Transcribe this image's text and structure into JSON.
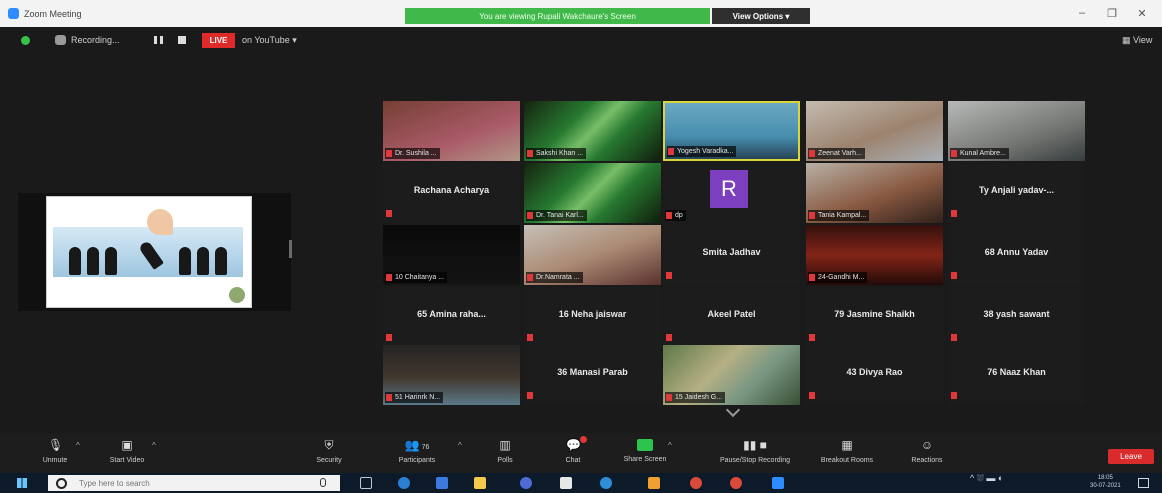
{
  "window": {
    "title": "Zoom Meeting",
    "share_banner": "You are viewing Rupali Wakchaure's Screen",
    "view_options": "View Options",
    "controls": [
      "–",
      "❐",
      "✕"
    ]
  },
  "recording_bar": {
    "recording_label": "Recording...",
    "live_badge": "LIVE",
    "live_platform": "on YouTube ▾",
    "view_label": "View"
  },
  "gallery": [
    {
      "kind": "video",
      "name": "Dr. Sushila ...",
      "video": "v-pink",
      "speaking": false
    },
    {
      "kind": "video",
      "name": "Sakshi Khan ...",
      "video": "v-dna",
      "speaking": false
    },
    {
      "kind": "video",
      "name": "Yogesh Varadka...",
      "video": "v-blue",
      "speaking": true
    },
    {
      "kind": "video",
      "name": "Zeenat Varh...",
      "video": "v-room",
      "speaking": false
    },
    {
      "kind": "video",
      "name": "Kunal Ambre...",
      "video": "v-lightroom",
      "speaking": false
    },
    {
      "kind": "name",
      "name": "Rachana Acharya"
    },
    {
      "kind": "video",
      "name": "Dr. Tanai Karl...",
      "video": "v-dna",
      "speaking": false
    },
    {
      "kind": "avatar",
      "name": "dp",
      "letter": "R"
    },
    {
      "kind": "video",
      "name": "Tania Kampal...",
      "video": "v-girl",
      "speaking": false
    },
    {
      "kind": "name",
      "name": "Ty Anjali yadav-..."
    },
    {
      "kind": "video",
      "name": "10 Chaitanya ...",
      "video": "v-dark",
      "speaking": false
    },
    {
      "kind": "video",
      "name": "Dr.Namrata ...",
      "video": "v-woman",
      "speaking": false
    },
    {
      "kind": "name",
      "name": "Smita Jadhav"
    },
    {
      "kind": "video",
      "name": "24-Gandhi M...",
      "video": "v-red",
      "speaking": false
    },
    {
      "kind": "name",
      "name": "68 Annu Yadav"
    },
    {
      "kind": "name",
      "name": "65 Amina raha..."
    },
    {
      "kind": "name",
      "name": "16 Neha jaiswar"
    },
    {
      "kind": "name",
      "name": "Akeel Patel"
    },
    {
      "kind": "name",
      "name": "79 Jasmine Shaikh"
    },
    {
      "kind": "name",
      "name": "38 yash sawant"
    },
    {
      "kind": "video",
      "name": "51 Harinrk N...",
      "video": "v-boy",
      "speaking": false
    },
    {
      "kind": "name",
      "name": "36 Manasi Parab"
    },
    {
      "kind": "video",
      "name": "15 Jaidesh G...",
      "video": "v-pattern",
      "speaking": false
    },
    {
      "kind": "name",
      "name": "43 Divya Rao"
    },
    {
      "kind": "name",
      "name": "76 Naaz Khan"
    }
  ],
  "toolbar": {
    "unmute": "Unmute",
    "start_video": "Start Video",
    "security": "Security",
    "participants": "Participants",
    "participants_count": "76",
    "polls": "Polls",
    "chat": "Chat",
    "share_screen": "Share Screen",
    "recording": "Pause/Stop Recording",
    "breakout": "Breakout Rooms",
    "reactions": "Reactions",
    "leave": "Leave"
  },
  "taskbar": {
    "search_placeholder": "Type here to search",
    "time": "18:05",
    "date": "30-07-2021"
  },
  "colors": {
    "share_green": "#41b94a",
    "live_red": "#e02a2a",
    "speaker_yellow": "#d9d63b",
    "leave_red": "#d92b2b",
    "avatar_purple": "#7b3fbf"
  }
}
